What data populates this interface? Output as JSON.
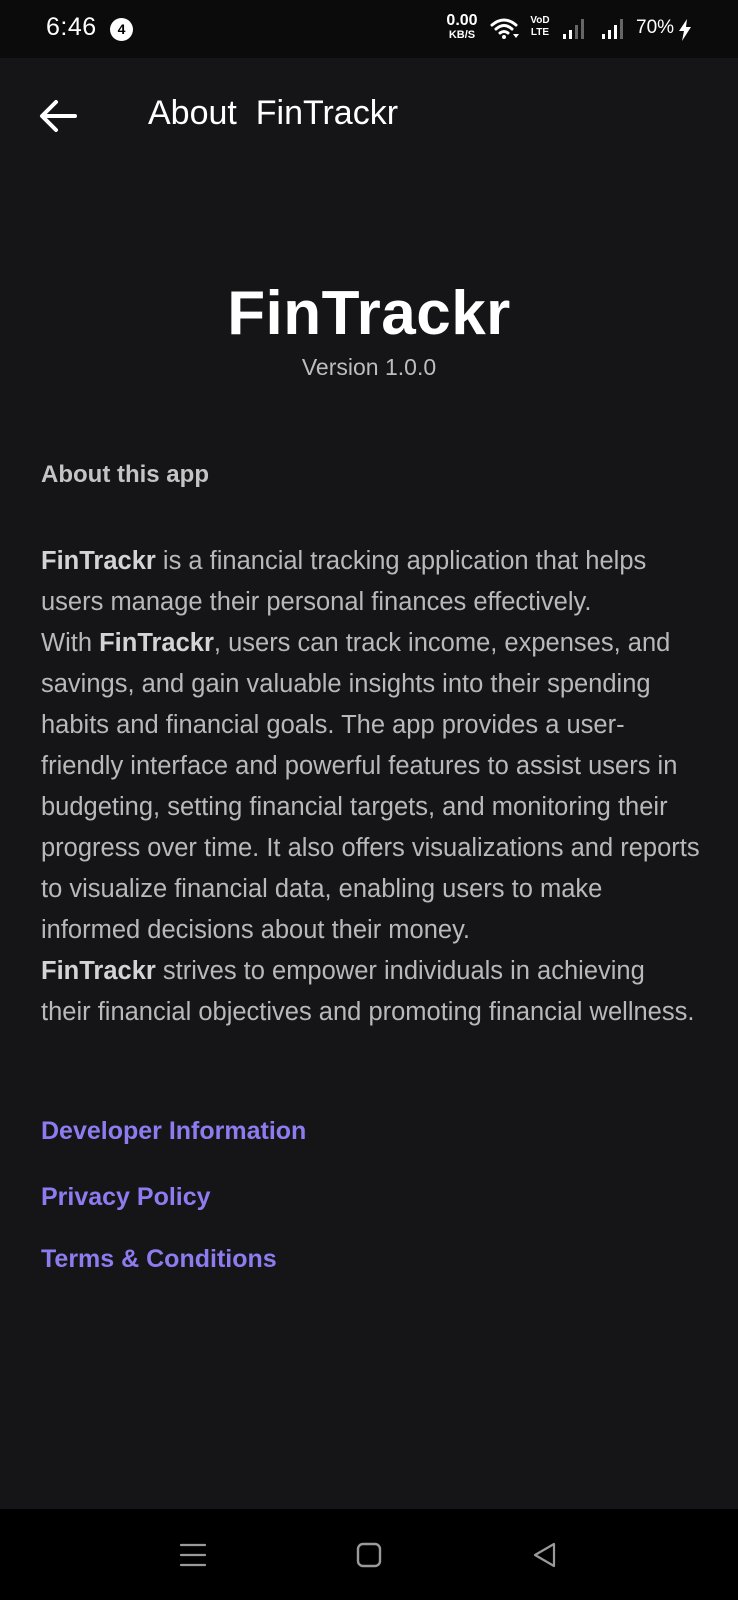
{
  "status_bar": {
    "time": "6:46",
    "notification_count": "4",
    "net_speed_value": "0.00",
    "net_speed_unit": "KB/S",
    "volte_top": "VoD",
    "volte_bottom": "LTE",
    "battery": "70%"
  },
  "app_bar": {
    "title": "About  FinTrackr"
  },
  "header": {
    "app_name": "FinTrackr",
    "version": "Version 1.0.0"
  },
  "about": {
    "heading": "About this app",
    "brand": "FinTrackr",
    "p1_rest": " is a financial tracking application that helps users manage their personal finances effectively.",
    "p2_lead": "With ",
    "p2_rest": ", users can track income, expenses, and savings, and gain valuable insights into their spending habits and financial goals. The app provides a user-friendly interface and powerful features to assist users in budgeting, setting financial targets, and monitoring their progress over time. It also offers visualizations and reports to visualize financial data, enabling users to make informed decisions about their money.",
    "p3_rest": " strives to empower individuals in achieving their financial objectives and promoting financial wellness."
  },
  "links": {
    "developer": "Developer Information",
    "privacy": "Privacy Policy",
    "terms": "Terms & Conditions"
  },
  "colors": {
    "background": "#151517",
    "link": "#8d7cf0",
    "text": "#b9b9b9"
  }
}
